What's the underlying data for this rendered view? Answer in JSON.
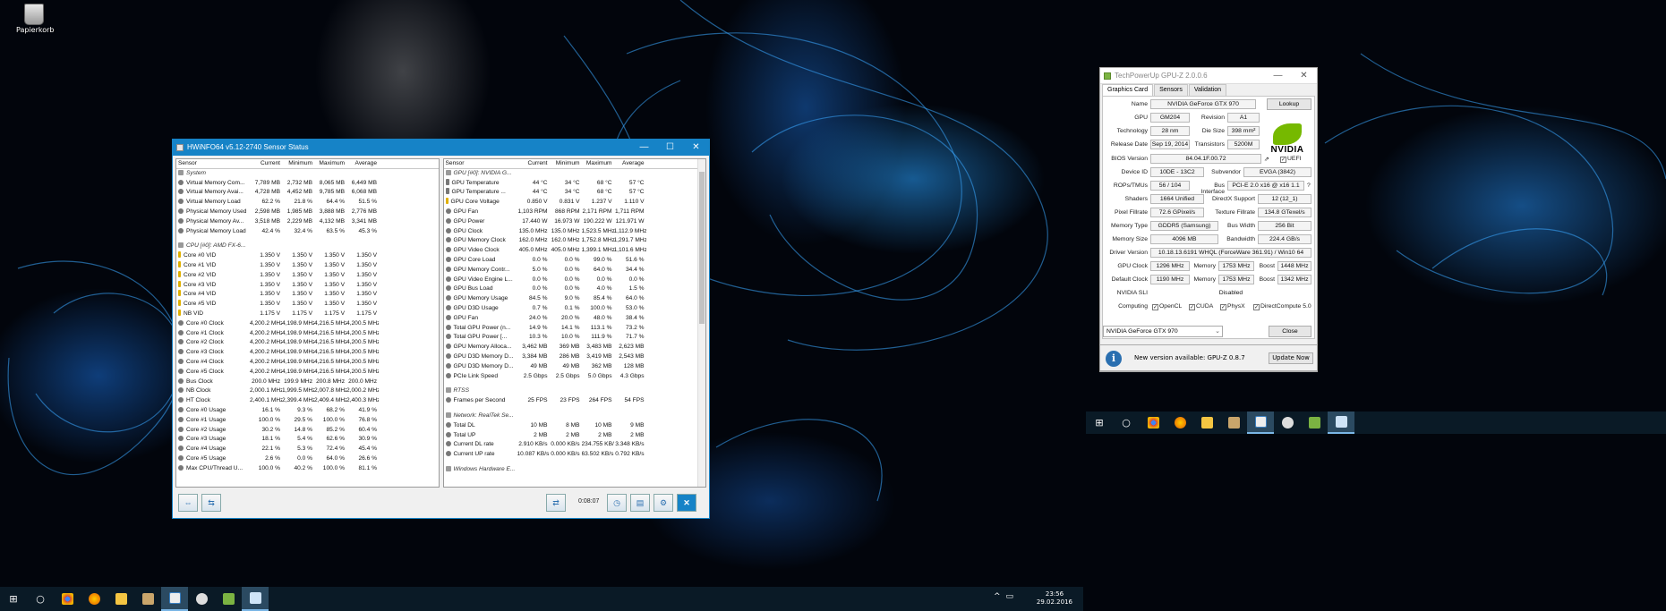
{
  "desktop": {
    "recycle_bin_label": "Papierkorb"
  },
  "hwinfo": {
    "title": "HWiNFO64 v5.12-2740 Sensor Status",
    "columns": [
      "Sensor",
      "Current",
      "Minimum",
      "Maximum",
      "Average"
    ],
    "left_rows": [
      {
        "k": "g",
        "n": "System"
      },
      {
        "n": "Virtual Memory Com...",
        "v": [
          "7,789 MB",
          "2,732 MB",
          "8,065 MB",
          "6,449 MB"
        ]
      },
      {
        "n": "Virtual Memory Avai...",
        "v": [
          "4,728 MB",
          "4,452 MB",
          "9,785 MB",
          "6,068 MB"
        ]
      },
      {
        "n": "Virtual Memory Load",
        "v": [
          "62.2 %",
          "21.8 %",
          "64.4 %",
          "51.5 %"
        ]
      },
      {
        "n": "Physical Memory Used",
        "v": [
          "2,598 MB",
          "1,985 MB",
          "3,888 MB",
          "2,776 MB"
        ]
      },
      {
        "n": "Physical Memory Av...",
        "v": [
          "3,518 MB",
          "2,229 MB",
          "4,132 MB",
          "3,341 MB"
        ]
      },
      {
        "n": "Physical Memory Load",
        "v": [
          "42.4 %",
          "32.4 %",
          "63.5 %",
          "45.3 %"
        ]
      },
      {
        "k": "s"
      },
      {
        "k": "g",
        "n": "CPU [#0]: AMD FX-6..."
      },
      {
        "k": "v",
        "n": "Core #0 VID",
        "v": [
          "1.350 V",
          "1.350 V",
          "1.350 V",
          "1.350 V"
        ]
      },
      {
        "k": "v",
        "n": "Core #1 VID",
        "v": [
          "1.350 V",
          "1.350 V",
          "1.350 V",
          "1.350 V"
        ]
      },
      {
        "k": "v",
        "n": "Core #2 VID",
        "v": [
          "1.350 V",
          "1.350 V",
          "1.350 V",
          "1.350 V"
        ]
      },
      {
        "k": "v",
        "n": "Core #3 VID",
        "v": [
          "1.350 V",
          "1.350 V",
          "1.350 V",
          "1.350 V"
        ]
      },
      {
        "k": "v",
        "n": "Core #4 VID",
        "v": [
          "1.350 V",
          "1.350 V",
          "1.350 V",
          "1.350 V"
        ]
      },
      {
        "k": "v",
        "n": "Core #5 VID",
        "v": [
          "1.350 V",
          "1.350 V",
          "1.350 V",
          "1.350 V"
        ]
      },
      {
        "k": "v",
        "n": "NB VID",
        "v": [
          "1.175 V",
          "1.175 V",
          "1.175 V",
          "1.175 V"
        ]
      },
      {
        "n": "Core #0 Clock",
        "v": [
          "4,200.2 MHz",
          "4,198.9 MHz",
          "4,216.5 MHz",
          "4,200.5 MHz"
        ]
      },
      {
        "n": "Core #1 Clock",
        "v": [
          "4,200.2 MHz",
          "4,198.9 MHz",
          "4,216.5 MHz",
          "4,200.5 MHz"
        ]
      },
      {
        "n": "Core #2 Clock",
        "v": [
          "4,200.2 MHz",
          "4,198.9 MHz",
          "4,216.5 MHz",
          "4,200.5 MHz"
        ]
      },
      {
        "n": "Core #3 Clock",
        "v": [
          "4,200.2 MHz",
          "4,198.9 MHz",
          "4,216.5 MHz",
          "4,200.5 MHz"
        ]
      },
      {
        "n": "Core #4 Clock",
        "v": [
          "4,200.2 MHz",
          "4,198.9 MHz",
          "4,216.5 MHz",
          "4,200.5 MHz"
        ]
      },
      {
        "n": "Core #5 Clock",
        "v": [
          "4,200.2 MHz",
          "4,198.9 MHz",
          "4,216.5 MHz",
          "4,200.5 MHz"
        ]
      },
      {
        "n": "Bus Clock",
        "v": [
          "200.0 MHz",
          "199.9 MHz",
          "200.8 MHz",
          "200.0 MHz"
        ]
      },
      {
        "n": "NB Clock",
        "v": [
          "2,000.1 MHz",
          "1,999.5 MHz",
          "2,007.8 MHz",
          "2,000.2 MHz"
        ]
      },
      {
        "n": "HT Clock",
        "v": [
          "2,400.1 MHz",
          "2,399.4 MHz",
          "2,409.4 MHz",
          "2,400.3 MHz"
        ]
      },
      {
        "n": "Core #0 Usage",
        "v": [
          "16.1 %",
          "9.3 %",
          "68.2 %",
          "41.9 %"
        ]
      },
      {
        "n": "Core #1 Usage",
        "v": [
          "100.0 %",
          "29.5 %",
          "100.0 %",
          "76.8 %"
        ]
      },
      {
        "n": "Core #2 Usage",
        "v": [
          "30.2 %",
          "14.8 %",
          "85.2 %",
          "60.4 %"
        ]
      },
      {
        "n": "Core #3 Usage",
        "v": [
          "18.1 %",
          "5.4 %",
          "62.6 %",
          "30.9 %"
        ]
      },
      {
        "n": "Core #4 Usage",
        "v": [
          "22.1 %",
          "5.3 %",
          "72.4 %",
          "45.4 %"
        ]
      },
      {
        "n": "Core #5 Usage",
        "v": [
          "2.6 %",
          "0.0 %",
          "64.0 %",
          "26.6 %"
        ]
      },
      {
        "n": "Max CPU/Thread U...",
        "v": [
          "100.0 %",
          "40.2 %",
          "100.0 %",
          "81.1 %"
        ]
      }
    ],
    "right_rows": [
      {
        "k": "g",
        "n": "GPU [#0]: NVIDIA G..."
      },
      {
        "k": "t",
        "n": "GPU Temperature",
        "v": [
          "44 °C",
          "34 °C",
          "68 °C",
          "57 °C"
        ]
      },
      {
        "k": "t",
        "n": "GPU Temperature ...",
        "v": [
          "44 °C",
          "34 °C",
          "68 °C",
          "57 °C"
        ]
      },
      {
        "k": "v",
        "n": "GPU Core Voltage",
        "v": [
          "0.850 V",
          "0.831 V",
          "1.237 V",
          "1.110 V"
        ]
      },
      {
        "n": "GPU Fan",
        "v": [
          "1,103 RPM",
          "868 RPM",
          "2,171 RPM",
          "1,711 RPM"
        ]
      },
      {
        "n": "GPU Power",
        "v": [
          "17.440 W",
          "16.973 W",
          "190.222 W",
          "121.971 W"
        ]
      },
      {
        "n": "GPU Clock",
        "v": [
          "135.0 MHz",
          "135.0 MHz",
          "1,523.5 MHz",
          "1,112.9 MHz"
        ]
      },
      {
        "n": "GPU Memory Clock",
        "v": [
          "162.0 MHz",
          "162.0 MHz",
          "1,752.8 MHz",
          "1,291.7 MHz"
        ]
      },
      {
        "n": "GPU Video Clock",
        "v": [
          "405.0 MHz",
          "405.0 MHz",
          "1,399.1 MHz",
          "1,101.6 MHz"
        ]
      },
      {
        "n": "GPU Core Load",
        "v": [
          "0.0 %",
          "0.0 %",
          "99.0 %",
          "51.6 %"
        ]
      },
      {
        "n": "GPU Memory Contr...",
        "v": [
          "5.0 %",
          "0.0 %",
          "64.0 %",
          "34.4 %"
        ]
      },
      {
        "n": "GPU Video Engine L...",
        "v": [
          "0.0 %",
          "0.0 %",
          "0.0 %",
          "0.0 %"
        ]
      },
      {
        "n": "GPU Bus Load",
        "v": [
          "0.0 %",
          "0.0 %",
          "4.0 %",
          "1.5 %"
        ]
      },
      {
        "n": "GPU Memory Usage",
        "v": [
          "84.5 %",
          "9.0 %",
          "85.4 %",
          "64.0 %"
        ]
      },
      {
        "n": "GPU D3D Usage",
        "v": [
          "0.7 %",
          "0.1 %",
          "100.0 %",
          "53.0 %"
        ]
      },
      {
        "n": "GPU Fan",
        "v": [
          "24.0 %",
          "20.0 %",
          "48.0 %",
          "38.4 %"
        ]
      },
      {
        "n": "Total GPU Power (n...",
        "v": [
          "14.9 %",
          "14.1 %",
          "113.1 %",
          "73.2 %"
        ]
      },
      {
        "n": "Total GPU Power [...",
        "v": [
          "10.3 %",
          "10.0 %",
          "111.9 %",
          "71.7 %"
        ]
      },
      {
        "n": "GPU Memory Alloca...",
        "v": [
          "3,462 MB",
          "369 MB",
          "3,483 MB",
          "2,623 MB"
        ]
      },
      {
        "n": "GPU D3D Memory D...",
        "v": [
          "3,384 MB",
          "286 MB",
          "3,419 MB",
          "2,543 MB"
        ]
      },
      {
        "n": "GPU D3D Memory D...",
        "v": [
          "49 MB",
          "49 MB",
          "362 MB",
          "128 MB"
        ]
      },
      {
        "n": "PCIe Link Speed",
        "v": [
          "2.5 Gbps",
          "2.5 Gbps",
          "5.0 Gbps",
          "4.3 Gbps"
        ]
      },
      {
        "k": "s"
      },
      {
        "k": "g",
        "n": "RTSS"
      },
      {
        "n": "Frames per Second",
        "v": [
          "25 FPS",
          "23 FPS",
          "264 FPS",
          "54 FPS"
        ]
      },
      {
        "k": "s"
      },
      {
        "k": "g",
        "n": "Network: RealTek Se..."
      },
      {
        "n": "Total DL",
        "v": [
          "10 MB",
          "8 MB",
          "10 MB",
          "9 MB"
        ]
      },
      {
        "n": "Total UP",
        "v": [
          "2 MB",
          "2 MB",
          "2 MB",
          "2 MB"
        ]
      },
      {
        "n": "Current DL rate",
        "v": [
          "2.910 KB/s",
          "0.000 KB/s",
          "234.755 KB/s",
          "3.348 KB/s"
        ]
      },
      {
        "n": "Current UP rate",
        "v": [
          "10.087 KB/s",
          "0.000 KB/s",
          "63.502 KB/s",
          "0.792 KB/s"
        ]
      },
      {
        "k": "s"
      },
      {
        "k": "g",
        "n": "Windows Hardware E..."
      }
    ],
    "timer": "0:08:07"
  },
  "gpuz": {
    "title": "TechPowerUp GPU-Z 2.0.0.6",
    "tabs": [
      "Graphics Card",
      "Sensors",
      "Validation"
    ],
    "name_label": "Name",
    "name": "NVIDIA GeForce GTX 970",
    "lookup": "Lookup",
    "gpu_label": "GPU",
    "gpu": "GM204",
    "revision_label": "Revision",
    "revision": "A1",
    "technology_label": "Technology",
    "technology": "28 nm",
    "die_label": "Die Size",
    "die": "398 mm²",
    "release_label": "Release Date",
    "release": "Sep 19, 2014",
    "transistors_label": "Transistors",
    "transistors": "5200M",
    "bios_label": "BIOS Version",
    "bios": "84.04.1F.00.72",
    "uefi": "UEFI",
    "device_label": "Device ID",
    "device": "10DE - 13C2",
    "subvendor_label": "Subvendor",
    "subvendor": "EVGA (3842)",
    "rops_label": "ROPs/TMUs",
    "rops": "56 / 104",
    "bus_label": "Bus Interface",
    "bus": "PCI-E 2.0 x16 @ x16 1.1",
    "q": "?",
    "shaders_label": "Shaders",
    "shaders": "1664 Unified",
    "dx_label": "DirectX Support",
    "dx": "12 (12_1)",
    "pixel_label": "Pixel Fillrate",
    "pixel": "72.6 GPixel/s",
    "texture_label": "Texture Fillrate",
    "texture": "134.8 GTexel/s",
    "memtype_label": "Memory Type",
    "memtype": "GDDR5 (Samsung)",
    "buswidth_label": "Bus Width",
    "buswidth": "256 Bit",
    "memsize_label": "Memory Size",
    "memsize": "4096 MB",
    "bandwidth_label": "Bandwidth",
    "bandwidth": "224.4 GB/s",
    "driver_label": "Driver Version",
    "driver": "10.18.13.6191 WHQL (ForceWare 361.91) / Win10 64",
    "gpuclock_label": "GPU Clock",
    "gpuclock": "1296 MHz",
    "memory_label": "Memory",
    "memclock": "1753 MHz",
    "boost_label": "Boost",
    "boost": "1448 MHz",
    "defclock_label": "Default Clock",
    "defclock": "1190 MHz",
    "defmem": "1753 MHz",
    "defboost": "1342 MHz",
    "sli_label": "NVIDIA SLI",
    "sli": "Disabled",
    "computing_label": "Computing",
    "computing": [
      "OpenCL",
      "CUDA",
      "PhysX",
      "DirectCompute 5.0"
    ],
    "logo": "NVIDIA",
    "selected_card": "NVIDIA GeForce GTX 970",
    "close": "Close",
    "notify": "New version available: GPU-Z 0.8.7",
    "update": "Update Now"
  },
  "taskbar": {
    "time": "23:56",
    "date": "29.02.2016"
  }
}
